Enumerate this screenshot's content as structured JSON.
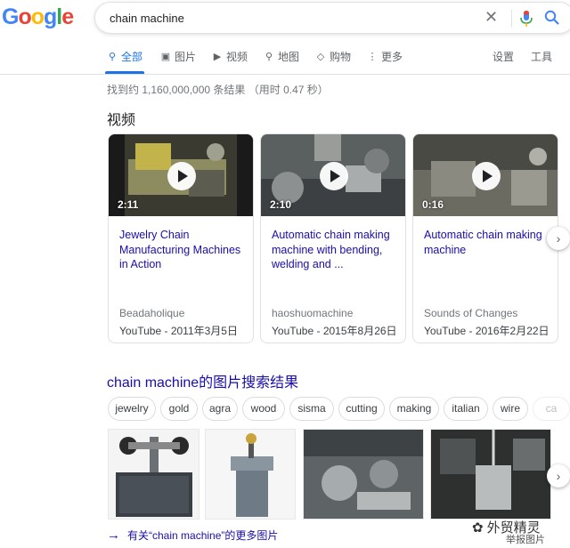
{
  "search": {
    "query": "chain machine"
  },
  "logo": {
    "text": "Google"
  },
  "tabs": [
    {
      "label": "全部",
      "icon": "search-icon"
    },
    {
      "label": "图片",
      "icon": "image-icon"
    },
    {
      "label": "视频",
      "icon": "video-icon"
    },
    {
      "label": "地图",
      "icon": "map-pin-icon"
    },
    {
      "label": "购物",
      "icon": "tag-icon"
    },
    {
      "label": "更多",
      "icon": "more-dots-icon"
    }
  ],
  "tools": {
    "settings": "设置",
    "tools": "工具"
  },
  "stats": "找到约 1,160,000,000 条结果 （用时 0.47 秒）",
  "videos": {
    "title": "视频",
    "items": [
      {
        "duration": "2:11",
        "title": "Jewelry Chain Manufacturing Machines in Action",
        "source": "Beadaholique",
        "meta": "YouTube - 2011年3月5日"
      },
      {
        "duration": "2:10",
        "title": "Automatic chain making machine with bending, welding and ...",
        "source": "haoshuomachine",
        "meta": "YouTube - 2015年8月26日"
      },
      {
        "duration": "0:16",
        "title": "Automatic chain making machine",
        "source": "Sounds of Changes",
        "meta": "YouTube - 2016年2月22日"
      }
    ]
  },
  "images": {
    "title": "chain machine的图片搜索结果",
    "chips": [
      "jewelry",
      "gold",
      "agra",
      "wood",
      "sisma",
      "cutting",
      "making",
      "italian",
      "wire",
      "ca"
    ],
    "more_link": "有关“chain machine”的更多图片"
  },
  "watermark": {
    "text": "外贸精灵",
    "sub": "举报图片"
  },
  "colors": {
    "link": "#1a0dab",
    "accent": "#1a73e8",
    "meta": "#70757a"
  }
}
